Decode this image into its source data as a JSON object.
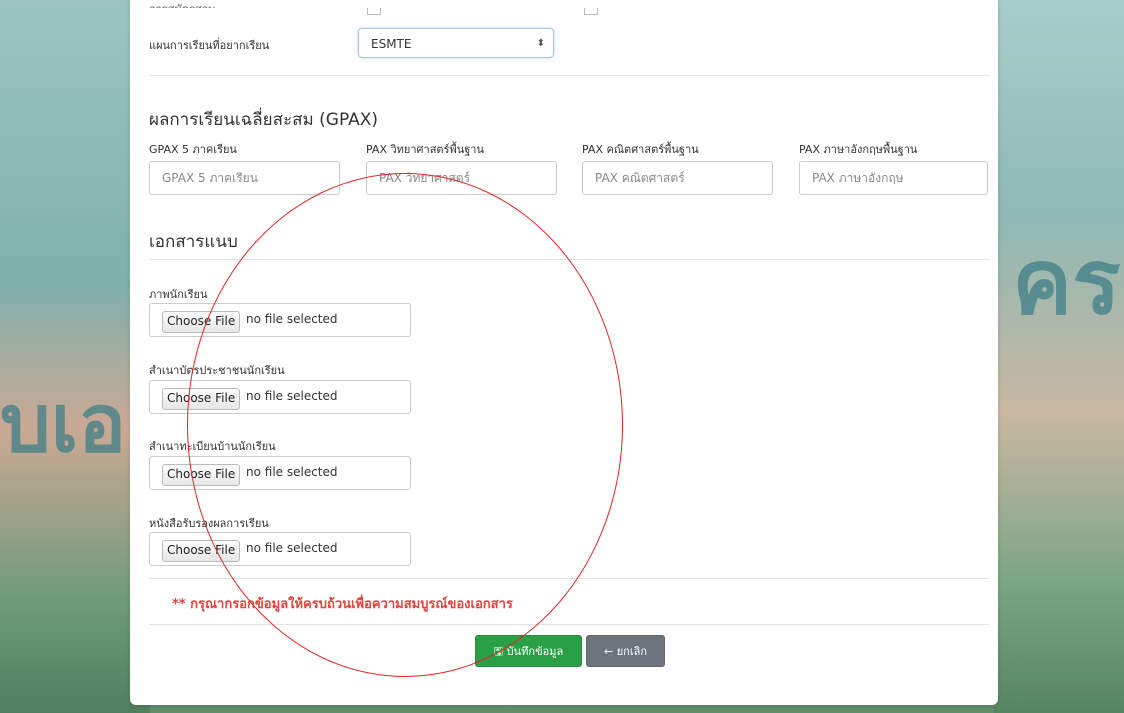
{
  "top_cutoff": {
    "label_partial": "การสมัครสอบ"
  },
  "plan": {
    "label": "แผนการเรียนที่อยากเรียน",
    "selected": "ESMTE"
  },
  "gpax": {
    "title": "ผลการเรียนเฉลี่ยสะสม (GPAX)",
    "fields": [
      {
        "label": "GPAX 5 ภาคเรียน",
        "placeholder": "GPAX 5 ภาคเรียน"
      },
      {
        "label": "PAX วิทยาศาสตร์พื้นฐาน",
        "placeholder": "PAX วิทยาศาสตร์"
      },
      {
        "label": "PAX คณิตศาสตร์พื้นฐาน",
        "placeholder": "PAX คณิตศาสตร์"
      },
      {
        "label": "PAX ภาษาอังกฤษพื้นฐาน",
        "placeholder": "PAX ภาษาอังกฤษ"
      }
    ]
  },
  "attachments": {
    "title": "เอกสารแนบ",
    "choose_label": "Choose File",
    "no_file": "no file selected",
    "items": [
      {
        "label": "ภาพนักเรียน"
      },
      {
        "label": "สำเนาบัตรประชาชนนักเรียน"
      },
      {
        "label": "สำเนาทะเบียนบ้านนักเรียน"
      },
      {
        "label": "หนังสือรับรองผลการเรียน"
      }
    ]
  },
  "warning": "** กรุณากรอกข้อมูลให้ครบถ้วนเพื่อความสมบูรณ์ของเอกสาร",
  "actions": {
    "save_icon": "floppy-disk-icon",
    "save_label": "บันทึกข้อมูล",
    "cancel_icon": "arrow-left-icon",
    "cancel_label": "ยกเลิก"
  },
  "colors": {
    "success": "#2aa046",
    "secondary": "#6c757d",
    "warning_text": "#e0443d",
    "annotation_circle": "#e02424"
  }
}
